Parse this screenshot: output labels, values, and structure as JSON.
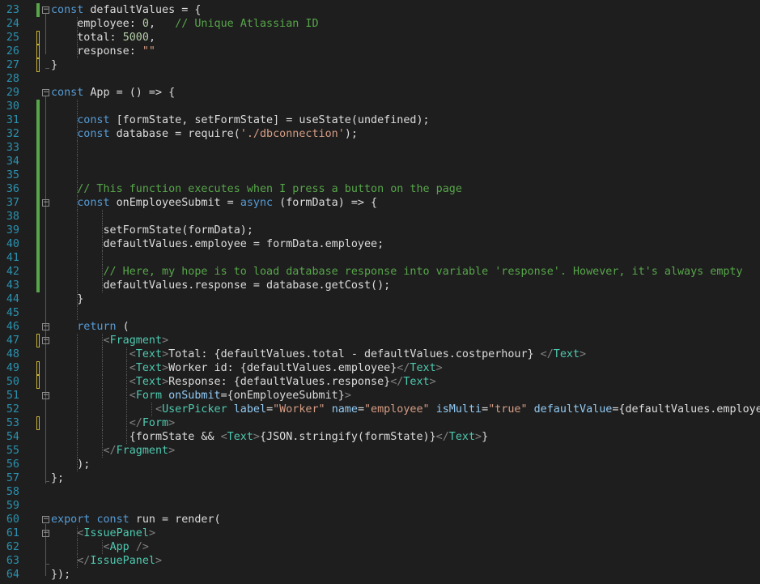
{
  "theme": {
    "background": "#1e1e1e",
    "line_number_color": "#2b91af",
    "change_bar_saved": "#57a64a",
    "change_bar_unsaved": "#c7b13c"
  },
  "lines": [
    {
      "n": "23",
      "fold": "minus",
      "gutter": "green",
      "segs": [
        [
          "kw",
          "const"
        ],
        [
          "txt",
          " defaultValues = {"
        ]
      ]
    },
    {
      "n": "24",
      "fold": "",
      "gutter": "",
      "segs": [
        [
          "txt",
          "    employee: "
        ],
        [
          "num",
          "0"
        ],
        [
          "txt",
          ",   "
        ],
        [
          "cm",
          "// Unique Atlassian ID"
        ]
      ]
    },
    {
      "n": "25",
      "fold": "",
      "gutter": "yellow",
      "segs": [
        [
          "txt",
          "    total: "
        ],
        [
          "num",
          "5000"
        ],
        [
          "txt",
          ","
        ]
      ]
    },
    {
      "n": "26",
      "fold": "",
      "gutter": "yellow",
      "segs": [
        [
          "txt",
          "    response: "
        ],
        [
          "str",
          "\"\""
        ]
      ]
    },
    {
      "n": "27",
      "fold": "",
      "gutter": "yellow",
      "segs": [
        [
          "txt",
          "}"
        ]
      ]
    },
    {
      "n": "28",
      "fold": "",
      "gutter": "",
      "segs": []
    },
    {
      "n": "29",
      "fold": "minus",
      "gutter": "",
      "segs": [
        [
          "kw",
          "const"
        ],
        [
          "txt",
          " App = () => {"
        ]
      ]
    },
    {
      "n": "30",
      "fold": "",
      "gutter": "green",
      "segs": []
    },
    {
      "n": "31",
      "fold": "",
      "gutter": "green",
      "segs": [
        [
          "txt",
          "    "
        ],
        [
          "kw",
          "const"
        ],
        [
          "txt",
          " [formState, setFormState] = useState(undefined);"
        ]
      ]
    },
    {
      "n": "32",
      "fold": "",
      "gutter": "green",
      "segs": [
        [
          "txt",
          "    "
        ],
        [
          "kw",
          "const"
        ],
        [
          "txt",
          " database = require("
        ],
        [
          "str",
          "'./dbconnection'"
        ],
        [
          "txt",
          ");"
        ]
      ]
    },
    {
      "n": "33",
      "fold": "",
      "gutter": "green",
      "segs": []
    },
    {
      "n": "34",
      "fold": "",
      "gutter": "green",
      "segs": []
    },
    {
      "n": "35",
      "fold": "",
      "gutter": "green",
      "segs": []
    },
    {
      "n": "36",
      "fold": "",
      "gutter": "green",
      "segs": [
        [
          "txt",
          "    "
        ],
        [
          "cm",
          "// This function executes when I press a button on the page"
        ]
      ]
    },
    {
      "n": "37",
      "fold": "minus",
      "gutter": "green",
      "segs": [
        [
          "txt",
          "    "
        ],
        [
          "kw",
          "const"
        ],
        [
          "txt",
          " onEmployeeSubmit = "
        ],
        [
          "kw",
          "async"
        ],
        [
          "txt",
          " (formData) => {"
        ]
      ]
    },
    {
      "n": "38",
      "fold": "",
      "gutter": "green",
      "segs": []
    },
    {
      "n": "39",
      "fold": "",
      "gutter": "green",
      "segs": [
        [
          "txt",
          "        setFormState(formData);"
        ]
      ]
    },
    {
      "n": "40",
      "fold": "",
      "gutter": "green",
      "segs": [
        [
          "txt",
          "        defaultValues.employee = formData.employee;"
        ]
      ]
    },
    {
      "n": "41",
      "fold": "",
      "gutter": "green",
      "segs": []
    },
    {
      "n": "42",
      "fold": "",
      "gutter": "green",
      "segs": [
        [
          "txt",
          "        "
        ],
        [
          "cm",
          "// Here, my hope is to load database response into variable 'response'. However, it's always empty"
        ]
      ]
    },
    {
      "n": "43",
      "fold": "",
      "gutter": "green",
      "segs": [
        [
          "txt",
          "        defaultValues.response = database.getCost();"
        ]
      ]
    },
    {
      "n": "44",
      "fold": "",
      "gutter": "",
      "segs": [
        [
          "txt",
          "    }"
        ]
      ]
    },
    {
      "n": "45",
      "fold": "",
      "gutter": "",
      "segs": []
    },
    {
      "n": "46",
      "fold": "minus",
      "gutter": "",
      "segs": [
        [
          "txt",
          "    "
        ],
        [
          "kw",
          "return"
        ],
        [
          "txt",
          " ("
        ]
      ]
    },
    {
      "n": "47",
      "fold": "minus",
      "gutter": "yellow",
      "segs": [
        [
          "txt",
          "        "
        ],
        [
          "punct",
          "<"
        ],
        [
          "tag",
          "Fragment"
        ],
        [
          "punct",
          ">"
        ]
      ]
    },
    {
      "n": "48",
      "fold": "",
      "gutter": "",
      "segs": [
        [
          "txt",
          "            "
        ],
        [
          "punct",
          "<"
        ],
        [
          "tag",
          "Text"
        ],
        [
          "punct",
          ">"
        ],
        [
          "txt",
          "Total: {defaultValues.total - defaultValues.costperhour} "
        ],
        [
          "punct",
          "</"
        ],
        [
          "tag",
          "Text"
        ],
        [
          "punct",
          ">"
        ]
      ]
    },
    {
      "n": "49",
      "fold": "",
      "gutter": "yellow",
      "segs": [
        [
          "txt",
          "            "
        ],
        [
          "punct",
          "<"
        ],
        [
          "tag",
          "Text"
        ],
        [
          "punct",
          ">"
        ],
        [
          "txt",
          "Worker id: {defaultValues.employee}"
        ],
        [
          "punct",
          "</"
        ],
        [
          "tag",
          "Text"
        ],
        [
          "punct",
          ">"
        ]
      ]
    },
    {
      "n": "50",
      "fold": "",
      "gutter": "yellow",
      "segs": [
        [
          "txt",
          "            "
        ],
        [
          "punct",
          "<"
        ],
        [
          "tag",
          "Text"
        ],
        [
          "punct",
          ">"
        ],
        [
          "txt",
          "Response: {defaultValues.response}"
        ],
        [
          "punct",
          "</"
        ],
        [
          "tag",
          "Text"
        ],
        [
          "punct",
          ">"
        ]
      ]
    },
    {
      "n": "51",
      "fold": "minus",
      "gutter": "",
      "segs": [
        [
          "txt",
          "            "
        ],
        [
          "punct",
          "<"
        ],
        [
          "tag",
          "Form"
        ],
        [
          "txt",
          " "
        ],
        [
          "attr",
          "onSubmit"
        ],
        [
          "txt",
          "={onEmployeeSubmit}"
        ],
        [
          "punct",
          ">"
        ]
      ]
    },
    {
      "n": "52",
      "fold": "",
      "gutter": "",
      "segs": [
        [
          "txt",
          "                "
        ],
        [
          "punct",
          "<"
        ],
        [
          "tag",
          "UserPicker"
        ],
        [
          "txt",
          " "
        ],
        [
          "attr",
          "label"
        ],
        [
          "txt",
          "="
        ],
        [
          "str",
          "\"Worker\""
        ],
        [
          "txt",
          " "
        ],
        [
          "attr",
          "name"
        ],
        [
          "txt",
          "="
        ],
        [
          "str",
          "\"employee\""
        ],
        [
          "txt",
          " "
        ],
        [
          "attr",
          "isMulti"
        ],
        [
          "txt",
          "="
        ],
        [
          "str",
          "\"true\""
        ],
        [
          "txt",
          " "
        ],
        [
          "attr",
          "defaultValue"
        ],
        [
          "txt",
          "={defaultValues.employee}"
        ],
        [
          "punct",
          "/>"
        ]
      ]
    },
    {
      "n": "53",
      "fold": "",
      "gutter": "yellow",
      "segs": [
        [
          "txt",
          "            "
        ],
        [
          "punct",
          "</"
        ],
        [
          "tag",
          "Form"
        ],
        [
          "punct",
          ">"
        ]
      ]
    },
    {
      "n": "54",
      "fold": "",
      "gutter": "",
      "segs": [
        [
          "txt",
          "            {formState && "
        ],
        [
          "punct",
          "<"
        ],
        [
          "tag",
          "Text"
        ],
        [
          "punct",
          ">"
        ],
        [
          "txt",
          "{JSON.stringify(formState)}"
        ],
        [
          "punct",
          "</"
        ],
        [
          "tag",
          "Text"
        ],
        [
          "punct",
          ">"
        ],
        [
          "txt",
          "}"
        ]
      ]
    },
    {
      "n": "55",
      "fold": "",
      "gutter": "",
      "segs": [
        [
          "txt",
          "        "
        ],
        [
          "punct",
          "</"
        ],
        [
          "tag",
          "Fragment"
        ],
        [
          "punct",
          ">"
        ]
      ]
    },
    {
      "n": "56",
      "fold": "",
      "gutter": "",
      "segs": [
        [
          "txt",
          "    );"
        ]
      ]
    },
    {
      "n": "57",
      "fold": "",
      "gutter": "",
      "segs": [
        [
          "txt",
          "};"
        ]
      ]
    },
    {
      "n": "58",
      "fold": "",
      "gutter": "",
      "segs": []
    },
    {
      "n": "59",
      "fold": "",
      "gutter": "",
      "segs": []
    },
    {
      "n": "60",
      "fold": "minus",
      "gutter": "",
      "segs": [
        [
          "kw",
          "export"
        ],
        [
          "txt",
          " "
        ],
        [
          "kw",
          "const"
        ],
        [
          "txt",
          " run = render("
        ]
      ]
    },
    {
      "n": "61",
      "fold": "minus",
      "gutter": "",
      "segs": [
        [
          "txt",
          "    "
        ],
        [
          "punct",
          "<"
        ],
        [
          "tag",
          "IssuePanel"
        ],
        [
          "punct",
          ">"
        ]
      ]
    },
    {
      "n": "62",
      "fold": "",
      "gutter": "",
      "segs": [
        [
          "txt",
          "        "
        ],
        [
          "punct",
          "<"
        ],
        [
          "tag",
          "App"
        ],
        [
          "txt",
          " "
        ],
        [
          "punct",
          "/>"
        ]
      ]
    },
    {
      "n": "63",
      "fold": "",
      "gutter": "",
      "segs": [
        [
          "txt",
          "    "
        ],
        [
          "punct",
          "</"
        ],
        [
          "tag",
          "IssuePanel"
        ],
        [
          "punct",
          ">"
        ]
      ]
    },
    {
      "n": "64",
      "fold": "",
      "gutter": "",
      "segs": [
        [
          "txt",
          "});"
        ]
      ]
    }
  ]
}
